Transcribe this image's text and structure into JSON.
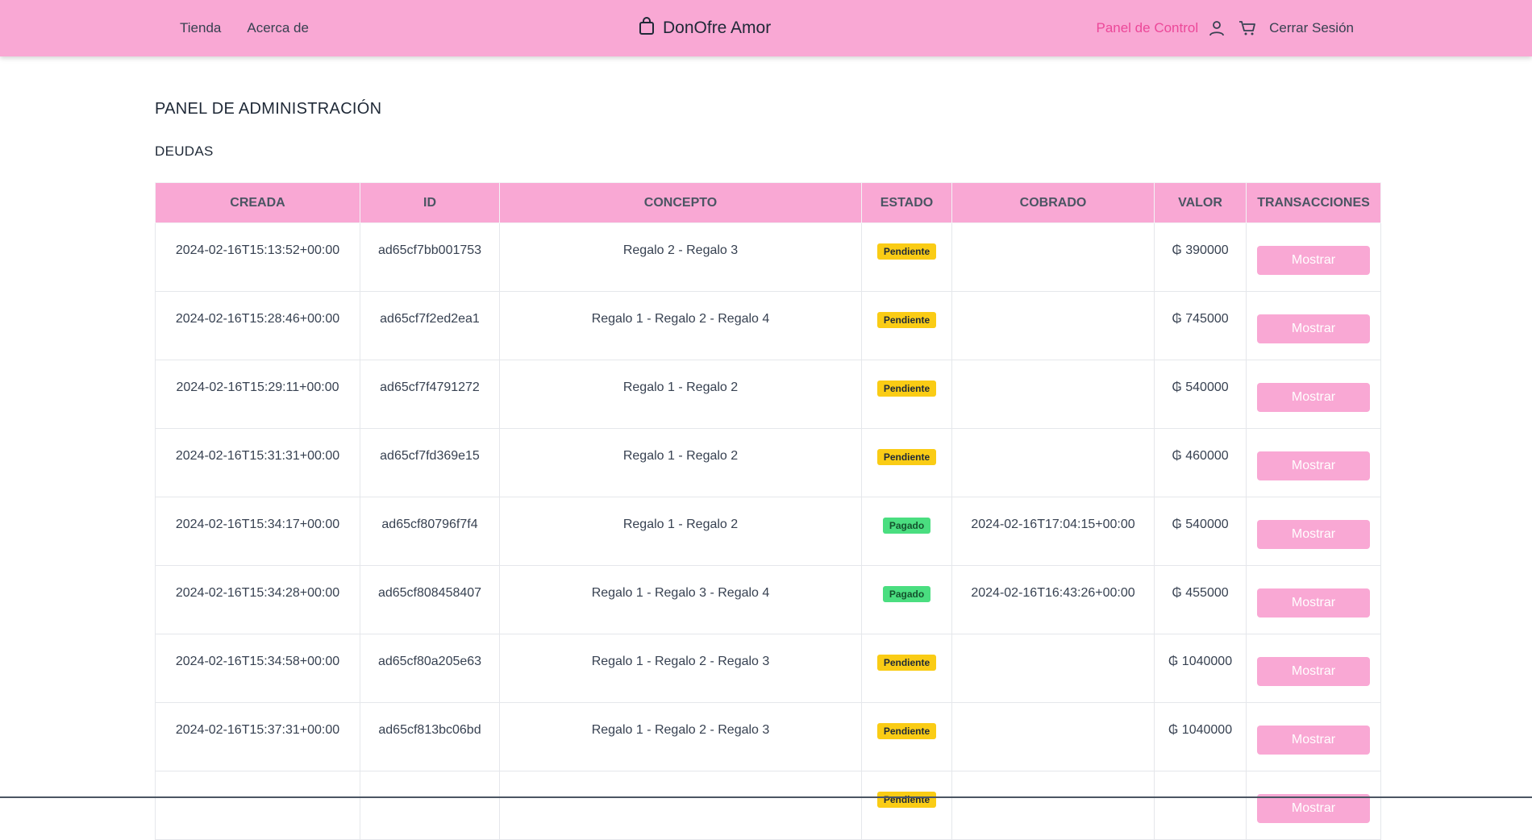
{
  "nav": {
    "left_links": [
      {
        "label": "Tienda"
      },
      {
        "label": "Acerca de"
      }
    ],
    "brand": {
      "icon": "shopping-bag-icon",
      "name": "DonOfre Amor"
    },
    "panel_link": "Panel de Control",
    "user_icon": "user-icon",
    "cart_icon": "cart-icon",
    "logout": "Cerrar Sesión"
  },
  "page": {
    "title": "PANEL DE ADMINISTRACIÓN",
    "section": "DEUDAS"
  },
  "table": {
    "headers": [
      "CREADA",
      "ID",
      "CONCEPTO",
      "ESTADO",
      "COBRADO",
      "VALOR",
      "TRANSACCIONES"
    ],
    "rows": [
      {
        "created": "2024-02-16T15:13:52+00:00",
        "id": "ad65cf7bb001753",
        "concept": "Regalo 2 - Regalo 3",
        "status": "Pendiente",
        "status_type": "pending",
        "paid_at": "",
        "value": "₲ 390000",
        "action": "Mostrar"
      },
      {
        "created": "2024-02-16T15:28:46+00:00",
        "id": "ad65cf7f2ed2ea1",
        "concept": "Regalo 1 - Regalo 2 - Regalo 4",
        "status": "Pendiente",
        "status_type": "pending",
        "paid_at": "",
        "value": "₲ 745000",
        "action": "Mostrar"
      },
      {
        "created": "2024-02-16T15:29:11+00:00",
        "id": "ad65cf7f4791272",
        "concept": "Regalo 1 - Regalo 2",
        "status": "Pendiente",
        "status_type": "pending",
        "paid_at": "",
        "value": "₲ 540000",
        "action": "Mostrar"
      },
      {
        "created": "2024-02-16T15:31:31+00:00",
        "id": "ad65cf7fd369e15",
        "concept": "Regalo 1 - Regalo 2",
        "status": "Pendiente",
        "status_type": "pending",
        "paid_at": "",
        "value": "₲ 460000",
        "action": "Mostrar"
      },
      {
        "created": "2024-02-16T15:34:17+00:00",
        "id": "ad65cf80796f7f4",
        "concept": "Regalo 1 - Regalo 2",
        "status": "Pagado",
        "status_type": "paid",
        "paid_at": "2024-02-16T17:04:15+00:00",
        "value": "₲ 540000",
        "action": "Mostrar"
      },
      {
        "created": "2024-02-16T15:34:28+00:00",
        "id": "ad65cf808458407",
        "concept": "Regalo 1 - Regalo 3 - Regalo 4",
        "status": "Pagado",
        "status_type": "paid",
        "paid_at": "2024-02-16T16:43:26+00:00",
        "value": "₲ 455000",
        "action": "Mostrar"
      },
      {
        "created": "2024-02-16T15:34:58+00:00",
        "id": "ad65cf80a205e63",
        "concept": "Regalo 1 - Regalo 2 - Regalo 3",
        "status": "Pendiente",
        "status_type": "pending",
        "paid_at": "",
        "value": "₲ 1040000",
        "action": "Mostrar"
      },
      {
        "created": "2024-02-16T15:37:31+00:00",
        "id": "ad65cf813bc06bd",
        "concept": "Regalo 1 - Regalo 2 - Regalo 3",
        "status": "Pendiente",
        "status_type": "pending",
        "paid_at": "",
        "value": "₲ 1040000",
        "action": "Mostrar"
      },
      {
        "created": "",
        "id": "",
        "concept": "",
        "status": "Pendiente",
        "status_type": "pending",
        "paid_at": "",
        "value": "",
        "action": "Mostrar"
      }
    ]
  },
  "colors": {
    "accent": "#f9a8d4",
    "link_active": "#ec4899",
    "pending": "#facc15",
    "paid": "#4ade80"
  }
}
